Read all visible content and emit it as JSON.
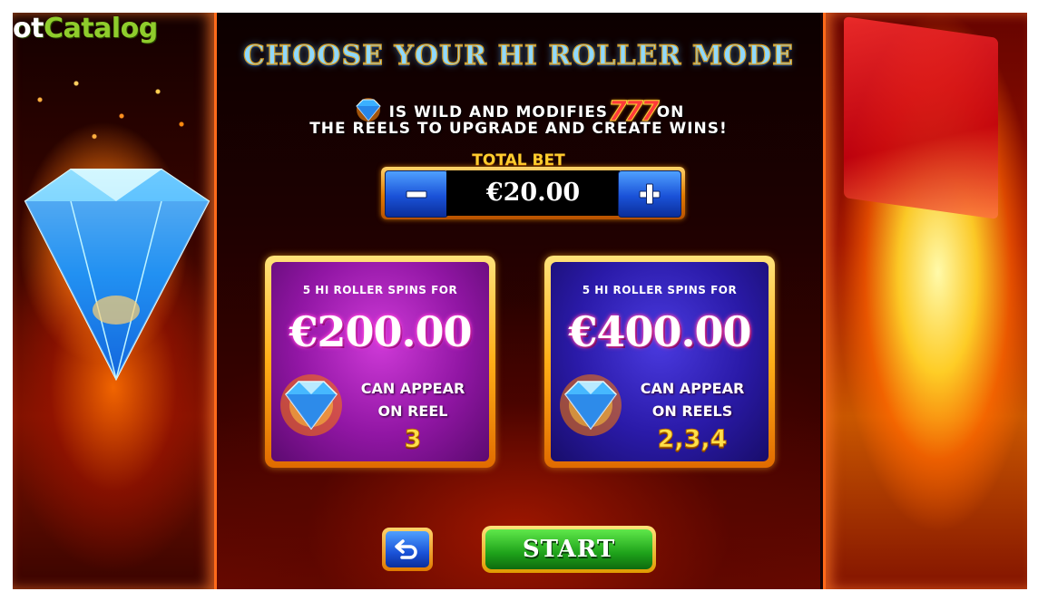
{
  "watermark": {
    "logo_part1": "ot",
    "logo_part2": "Catalog"
  },
  "screen": {
    "title": "CHOOSE YOUR HI ROLLER MODE",
    "description_line1": "IS WILD AND MODIFIES",
    "description_sevens": "777",
    "description_line1_end": "ON",
    "description_line2": "THE REELS TO UPGRADE AND CREATE WINS!"
  },
  "bet": {
    "label": "TOTAL BET",
    "value": "€20.00"
  },
  "options": [
    {
      "heading": "5 HI ROLLER SPINS FOR",
      "price": "€200.00",
      "line1": "CAN APPEAR",
      "line2": "ON REEL",
      "reels": "3",
      "color": "#9116a4"
    },
    {
      "heading": "5 HI ROLLER SPINS FOR",
      "price": "€400.00",
      "line1": "CAN APPEAR",
      "line2": "ON REELS",
      "reels": "2,3,4",
      "color": "#2a1aa8"
    }
  ],
  "actions": {
    "start_label": "START",
    "back_icon": "back-arrow-icon"
  },
  "colors": {
    "accent_gold": "#ffce2e",
    "button_blue": "#1a52d8",
    "start_green": "#1ea21a"
  }
}
